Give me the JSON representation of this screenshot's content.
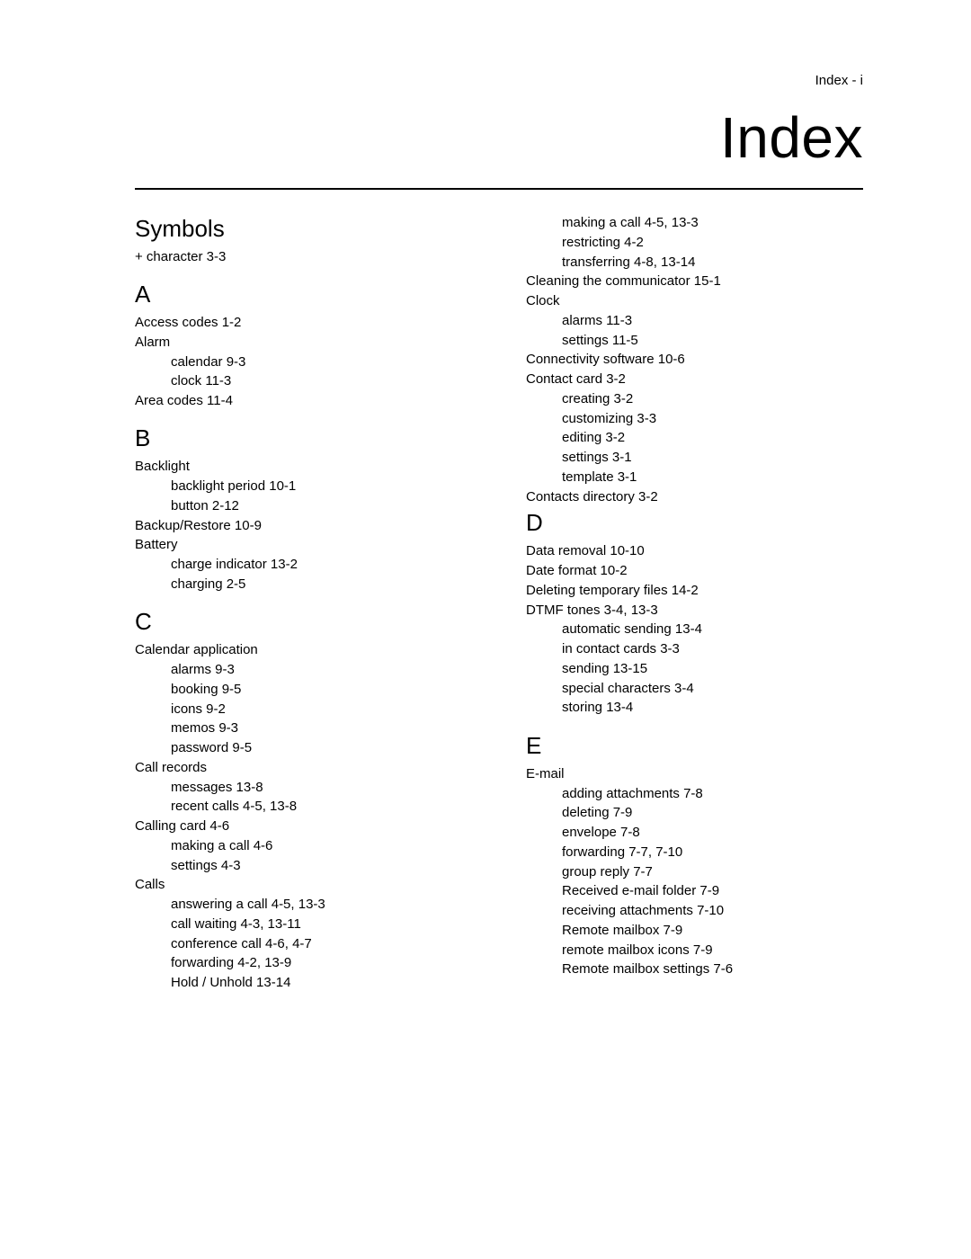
{
  "header": {
    "page_label": "Index - i",
    "title": "Index"
  },
  "left_column": [
    {
      "type": "head",
      "text": "Symbols"
    },
    {
      "type": "line",
      "text": "+ character 3-3"
    },
    {
      "type": "head",
      "text": "A"
    },
    {
      "type": "line",
      "text": "Access codes 1-2"
    },
    {
      "type": "line",
      "text": "Alarm"
    },
    {
      "type": "sub",
      "text": "calendar 9-3"
    },
    {
      "type": "sub",
      "text": "clock 11-3"
    },
    {
      "type": "line",
      "text": "Area codes 11-4"
    },
    {
      "type": "head",
      "text": "B"
    },
    {
      "type": "line",
      "text": "Backlight"
    },
    {
      "type": "sub",
      "text": "backlight period 10-1"
    },
    {
      "type": "sub",
      "text": "button 2-12"
    },
    {
      "type": "line",
      "text": "Backup/Restore 10-9"
    },
    {
      "type": "line",
      "text": "Battery"
    },
    {
      "type": "sub",
      "text": "charge indicator 13-2"
    },
    {
      "type": "sub",
      "text": "charging 2-5"
    },
    {
      "type": "head",
      "text": "C"
    },
    {
      "type": "line",
      "text": "Calendar application"
    },
    {
      "type": "sub",
      "text": "alarms 9-3"
    },
    {
      "type": "sub",
      "text": "booking 9-5"
    },
    {
      "type": "sub",
      "text": "icons 9-2"
    },
    {
      "type": "sub",
      "text": "memos 9-3"
    },
    {
      "type": "sub",
      "text": "password 9-5"
    },
    {
      "type": "line",
      "text": "Call records"
    },
    {
      "type": "sub",
      "text": "messages 13-8"
    },
    {
      "type": "sub",
      "text": "recent calls 4-5, 13-8"
    },
    {
      "type": "line",
      "text": "Calling card 4-6"
    },
    {
      "type": "sub",
      "text": "making a call 4-6"
    },
    {
      "type": "sub",
      "text": "settings 4-3"
    },
    {
      "type": "line",
      "text": "Calls"
    },
    {
      "type": "sub",
      "text": "answering a call 4-5, 13-3"
    },
    {
      "type": "sub",
      "text": "call waiting 4-3, 13-11"
    },
    {
      "type": "sub",
      "text": "conference call 4-6, 4-7"
    },
    {
      "type": "sub",
      "text": "forwarding 4-2, 13-9"
    },
    {
      "type": "sub",
      "text": "Hold / Unhold 13-14"
    }
  ],
  "right_column": [
    {
      "type": "sub",
      "text": "making a call 4-5, 13-3"
    },
    {
      "type": "sub",
      "text": "restricting 4-2"
    },
    {
      "type": "sub",
      "text": "transferring 4-8, 13-14"
    },
    {
      "type": "line",
      "text": "Cleaning the communicator 15-1"
    },
    {
      "type": "line",
      "text": "Clock"
    },
    {
      "type": "sub",
      "text": "alarms 11-3"
    },
    {
      "type": "sub",
      "text": "settings 11-5"
    },
    {
      "type": "line",
      "text": "Connectivity software 10-6"
    },
    {
      "type": "line",
      "text": "Contact card 3-2"
    },
    {
      "type": "sub",
      "text": "creating 3-2"
    },
    {
      "type": "sub",
      "text": "customizing 3-3"
    },
    {
      "type": "sub",
      "text": "editing 3-2"
    },
    {
      "type": "sub",
      "text": "settings 3-1"
    },
    {
      "type": "sub",
      "text": "template 3-1"
    },
    {
      "type": "line",
      "text": "Contacts directory 3-2"
    },
    {
      "type": "head",
      "text": "D"
    },
    {
      "type": "line",
      "text": "Data removal 10-10"
    },
    {
      "type": "line",
      "text": "Date format 10-2"
    },
    {
      "type": "line",
      "text": "Deleting temporary files 14-2"
    },
    {
      "type": "line",
      "text": "DTMF tones 3-4, 13-3"
    },
    {
      "type": "sub",
      "text": "automatic sending 13-4"
    },
    {
      "type": "sub",
      "text": "in contact cards 3-3"
    },
    {
      "type": "sub",
      "text": "sending 13-15"
    },
    {
      "type": "sub",
      "text": "special characters 3-4"
    },
    {
      "type": "sub",
      "text": "storing 13-4"
    },
    {
      "type": "head",
      "text": "E"
    },
    {
      "type": "line",
      "text": "E-mail"
    },
    {
      "type": "sub",
      "text": "adding attachments 7-8"
    },
    {
      "type": "sub",
      "text": "deleting 7-9"
    },
    {
      "type": "sub",
      "text": "envelope 7-8"
    },
    {
      "type": "sub",
      "text": "forwarding 7-7, 7-10"
    },
    {
      "type": "sub",
      "text": "group reply 7-7"
    },
    {
      "type": "sub",
      "text": "Received e-mail folder 7-9"
    },
    {
      "type": "sub",
      "text": "receiving attachments 7-10"
    },
    {
      "type": "sub",
      "text": "Remote mailbox 7-9"
    },
    {
      "type": "sub",
      "text": "remote mailbox icons 7-9"
    },
    {
      "type": "sub",
      "text": "Remote mailbox settings 7-6"
    }
  ]
}
